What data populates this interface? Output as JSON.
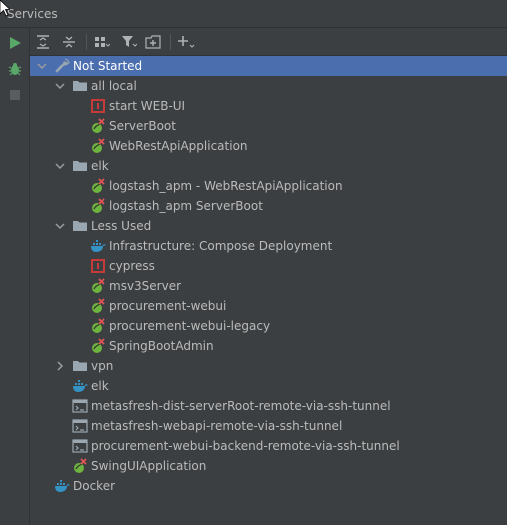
{
  "window": {
    "title": "Services"
  },
  "tree": {
    "root": {
      "label": "Not Started"
    },
    "all_local": {
      "label": "all local",
      "items": [
        {
          "label": "start WEB-UI"
        },
        {
          "label": "ServerBoot"
        },
        {
          "label": "WebRestApiApplication"
        }
      ]
    },
    "elk_group": {
      "label": "elk",
      "items": [
        {
          "label": "logstash_apm - WebRestApiApplication"
        },
        {
          "label": "logstash_apm ServerBoot"
        }
      ]
    },
    "less_used": {
      "label": "Less Used",
      "items": [
        {
          "label": "Infrastructure: Compose Deployment"
        },
        {
          "label": "cypress"
        },
        {
          "label": "msv3Server"
        },
        {
          "label": "procurement-webui"
        },
        {
          "label": "procurement-webui-legacy"
        },
        {
          "label": "SpringBootAdmin"
        }
      ]
    },
    "vpn": {
      "label": "vpn"
    },
    "elk_compose": {
      "label": "elk"
    },
    "tunnels": [
      {
        "label": "metasfresh-dist-serverRoot-remote-via-ssh-tunnel"
      },
      {
        "label": "metasfresh-webapi-remote-via-ssh-tunnel"
      },
      {
        "label": "procurement-webui-backend-remote-via-ssh-tunnel"
      }
    ],
    "swing": {
      "label": "SwingUIApplication"
    },
    "docker": {
      "label": "Docker"
    }
  },
  "colors": {
    "background": "#3c3f41",
    "selection": "#4b6eaf",
    "run_green": "#59a869",
    "error_red": "#e05555",
    "docker_blue": "#3592c4"
  },
  "icons": {
    "run": "play-icon",
    "debug": "bug-icon",
    "stop": "stop-icon",
    "expand_all": "expand-all-icon",
    "collapse_all": "collapse-all-icon",
    "group": "group-by-icon",
    "filter": "filter-icon",
    "new_tab": "open-in-new-tab-icon",
    "add": "add-service-icon",
    "service_spring": "spring-boot-icon",
    "service_npm": "npm-icon",
    "service_docker": "docker-icon",
    "service_ssh": "ssh-tunnel-icon",
    "folder": "folder-icon",
    "wrench": "wrench-icon"
  }
}
